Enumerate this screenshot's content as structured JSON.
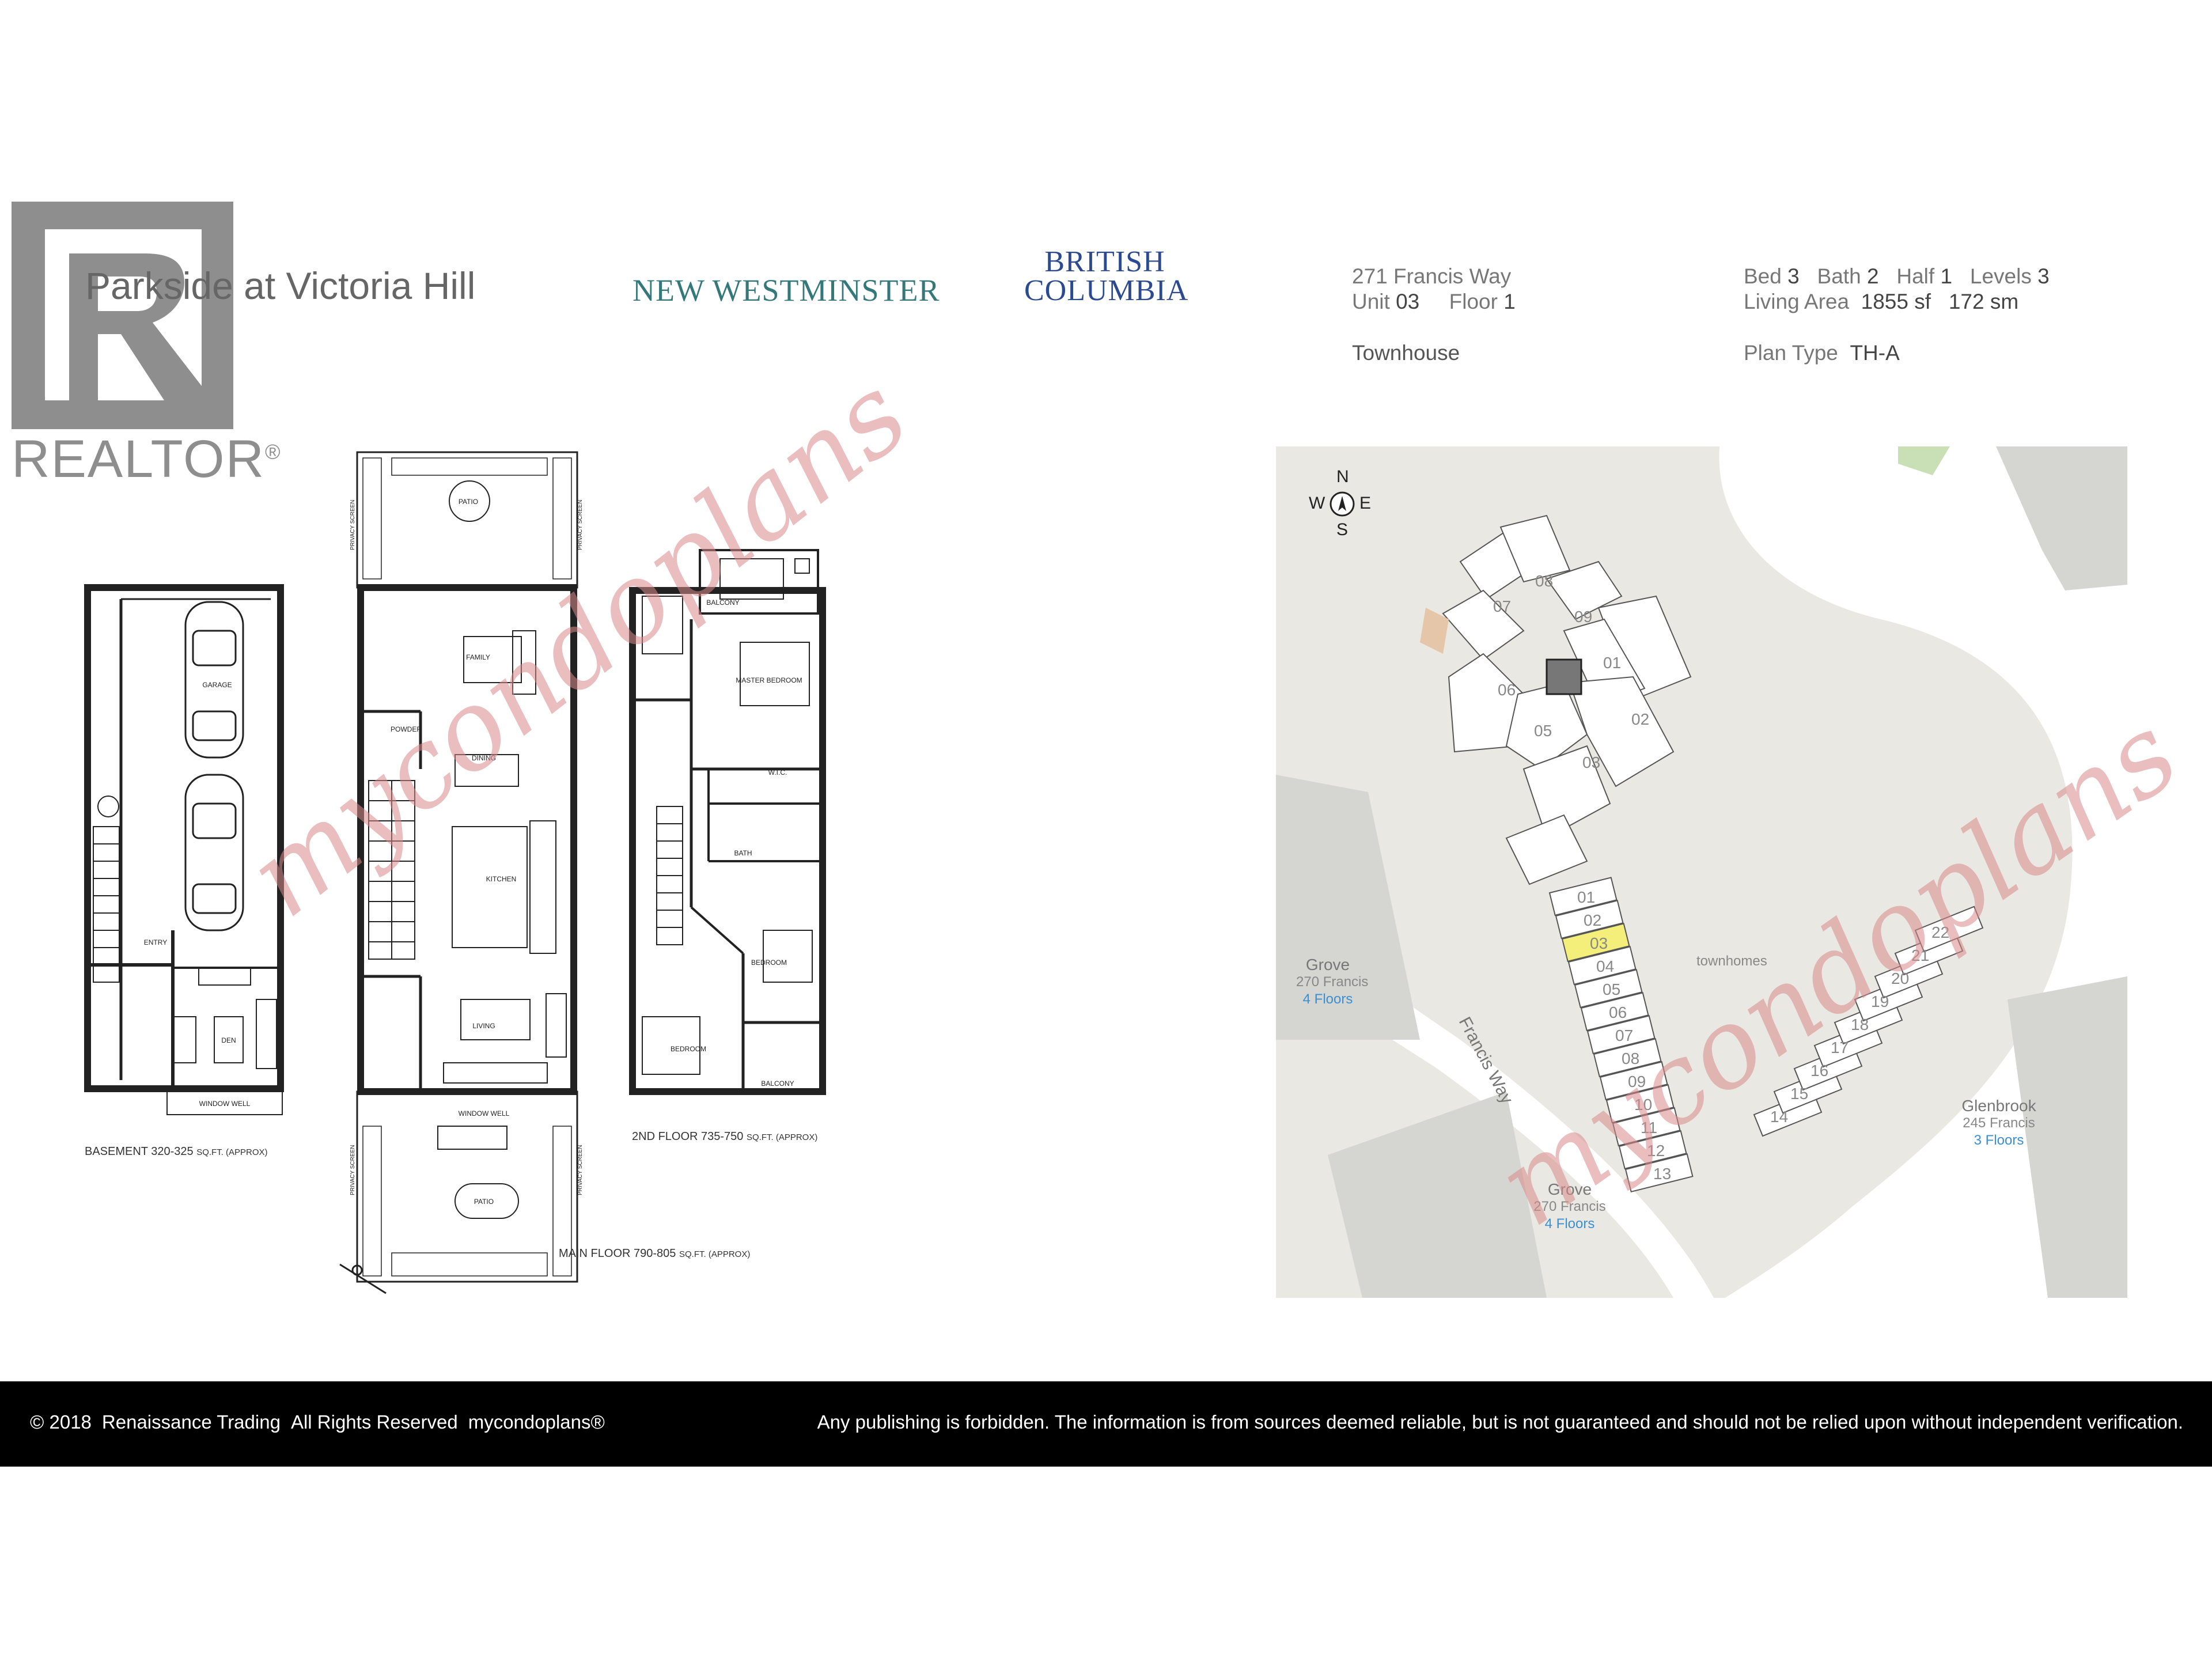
{
  "header": {
    "project_name": "Parkside at Victoria Hill",
    "city": "NEW WESTMINSTER",
    "province_line1": "BRITISH",
    "province_line2": "COLUMBIA",
    "address": "271 Francis Way",
    "unit_label": "Unit",
    "unit_value": "03",
    "floor_label": "Floor",
    "floor_value": "1",
    "property_type": "Townhouse",
    "bed_label": "Bed",
    "bed_value": "3",
    "bath_label": "Bath",
    "bath_value": "2",
    "half_label": "Half",
    "half_value": "1",
    "levels_label": "Levels",
    "levels_value": "3",
    "area_label": "Living Area",
    "area_sf": "1855 sf",
    "area_sm": "172 sm",
    "plan_label": "Plan Type",
    "plan_value": "TH-A"
  },
  "logo": {
    "text": "REALTOR",
    "mark": "®"
  },
  "floorplan": {
    "basement": {
      "title": "BASEMENT",
      "range": "320-325",
      "unit": "SQ.FT. (APPROX)"
    },
    "main": {
      "title": "MAIN FLOOR",
      "range": "790-805",
      "unit": "SQ.FT. (APPROX)"
    },
    "second": {
      "title": "2ND FLOOR",
      "range": "735-750",
      "unit": "SQ.FT. (APPROX)"
    },
    "rooms": {
      "garage": "GARAGE",
      "den": "DEN",
      "entry": "ENTRY",
      "window_well": "WINDOW WELL",
      "patio": "PATIO",
      "family": "FAMILY",
      "dining": "DINING",
      "kitchen": "KITCHEN",
      "living": "LIVING",
      "balcony": "BALCONY",
      "master_bedroom": "MASTER BEDROOM",
      "wic": "W.I.C.",
      "bath": "BATH",
      "bedroom": "BEDROOM",
      "privacy_screen": "PRIVACY SCREEN",
      "powder": "POWDER"
    }
  },
  "map": {
    "compass": {
      "n": "N",
      "s": "S",
      "e": "E",
      "w": "W"
    },
    "street": "Francis Way",
    "townhomes_label": "townhomes",
    "tower_units": [
      "01",
      "02",
      "03",
      "05",
      "06",
      "07",
      "08",
      "09"
    ],
    "townhouse_units_west": [
      "01",
      "02",
      "03",
      "04",
      "05",
      "06",
      "07",
      "08",
      "09",
      "10",
      "11",
      "12",
      "13"
    ],
    "townhouse_units_east": [
      "14",
      "15",
      "16",
      "17",
      "18",
      "19",
      "20",
      "21",
      "22"
    ],
    "highlighted_unit": "03",
    "highlight_color": "#f3ef7a",
    "neighbors": [
      {
        "name": "Grove",
        "address": "270 Francis",
        "floors": "4 Floors"
      },
      {
        "name": "Grove",
        "address": "270 Francis",
        "floors": "4 Floors"
      },
      {
        "name": "Glenbrook",
        "address": "245 Francis",
        "floors": "3 Floors"
      }
    ]
  },
  "watermark": {
    "text": "mycondoplans",
    "color": "#d98a8a"
  },
  "footer": {
    "copyright": "© 2018",
    "company": "Renaissance Trading",
    "rights": "All Rights Reserved",
    "brand": "mycondoplans®",
    "disclaimer": "Any publishing is forbidden.  The information is from sources deemed reliable, but is not guaranteed and should not be relied upon without independent verification."
  }
}
